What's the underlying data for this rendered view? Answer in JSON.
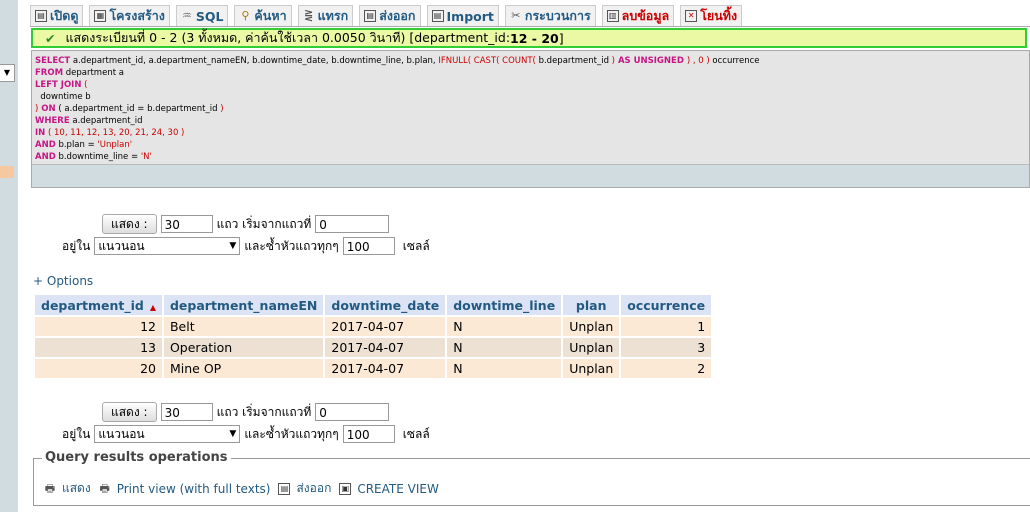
{
  "tabs": [
    {
      "label": "เปิดดู",
      "icon": "browse-icon"
    },
    {
      "label": "โครงสร้าง",
      "icon": "structure-icon"
    },
    {
      "label": "SQL",
      "icon": "sql-icon"
    },
    {
      "label": "ค้นหา",
      "icon": "search-icon"
    },
    {
      "label": "แทรก",
      "icon": "insert-icon"
    },
    {
      "label": "ส่งออก",
      "icon": "export-icon"
    },
    {
      "label": "Import",
      "icon": "import-icon"
    },
    {
      "label": "กระบวนการ",
      "icon": "operations-icon"
    },
    {
      "label": "ลบข้อมูล",
      "icon": "empty-icon"
    },
    {
      "label": "โยนทิ้ง",
      "icon": "drop-icon"
    }
  ],
  "success": {
    "text": "แสดงระเบียนที่ 0 - 2 (3 ทั้งหมด, ค่าค้นใช้เวลา 0.0050 วินาที) [department_id: ",
    "range": "12 - 20",
    "close": "]"
  },
  "sql": {
    "l1_kw": "SELECT",
    "l1_a": " a.department_id, a.department_nameEN, b.downtime_date, b.downtime_line, b.plan, ",
    "l1_fn1": "IFNULL( CAST( COUNT(",
    "l1_b": " b.department_id ",
    "l1_fn2": ")",
    "l1_kw2": " AS UNSIGNED ",
    "l1_fn3": ") , 0 )",
    "l1_c": " occurrence",
    "l2_kw": "FROM",
    "l2_a": " department a",
    "l3_kw": "LEFT JOIN",
    "l3_p": " (",
    "l4": "  downtime b",
    "l5_p": ")",
    "l5_kw": " ON",
    "l5_a": " ( a.department_id = b.department_id ",
    "l5_p2": ")",
    "l6_kw": "WHERE",
    "l6_a": " a.department_id",
    "l7_kw": "IN",
    "l7_a": " ( 10, 11, 12, 13, 20, 21, 24, 30 )",
    "l8_kw": "AND",
    "l8_a": " b.plan = ",
    "l8_s": "'Unplan'",
    "l9_kw": "AND",
    "l9_a": " b.downtime_line = ",
    "l9_s": "'N'"
  },
  "nav": {
    "show_button": "แสดง :",
    "rows": "30",
    "rows_label": "แถว เริ่มจากแถวที่",
    "start": "0",
    "in_label": "อยู่ใน",
    "mode": "แนวนอน",
    "repeat_label": "และซ้ำหัวแถวทุกๆ",
    "repeat": "100",
    "cells_label": "เซลล์"
  },
  "options_link": "+ Options",
  "table": {
    "headers": [
      "department_id",
      "department_nameEN",
      "downtime_date",
      "downtime_line",
      "plan",
      "occurrence"
    ],
    "rows": [
      [
        "12",
        "Belt",
        "2017-04-07",
        "N",
        "Unplan",
        "1"
      ],
      [
        "13",
        "Operation",
        "2017-04-07",
        "N",
        "Unplan",
        "3"
      ],
      [
        "20",
        "Mine OP",
        "2017-04-07",
        "N",
        "Unplan",
        "2"
      ]
    ]
  },
  "qro": {
    "legend": "Query results operations",
    "items": [
      {
        "label": "แสดง",
        "icon": "print-icon"
      },
      {
        "label": "Print view (with full texts)",
        "icon": "print-full-icon"
      },
      {
        "label": "ส่งออก",
        "icon": "export-icon"
      },
      {
        "label": "CREATE VIEW",
        "icon": "view-icon"
      }
    ]
  },
  "colors": {
    "accent": "#235a81",
    "success_border": "#32cd32",
    "danger": "#cc0000"
  }
}
